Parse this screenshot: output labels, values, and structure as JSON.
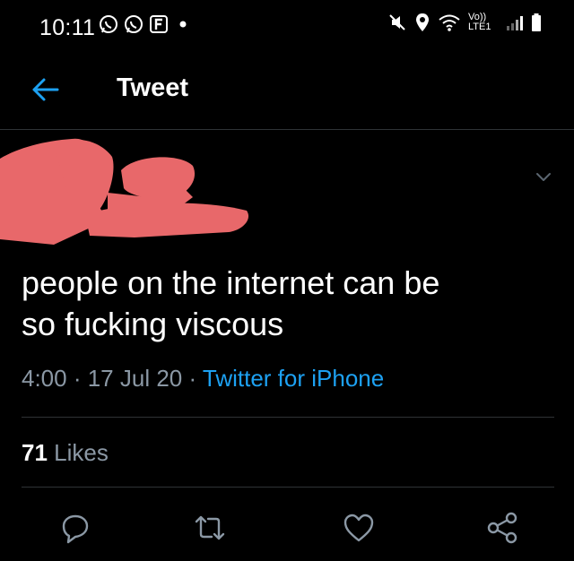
{
  "status_bar": {
    "time": "10:11",
    "network_label": "Vo)) LTE1"
  },
  "header": {
    "title": "Tweet"
  },
  "tweet": {
    "text_line1": "people on the internet can be",
    "text_line2": "so fucking viscous",
    "time": "4:00",
    "date": "17 Jul 20",
    "source": "Twitter for iPhone",
    "separator": " · "
  },
  "stats": {
    "likes_count": "71",
    "likes_label": "Likes"
  },
  "colors": {
    "background": "#000000",
    "text": "#ffffff",
    "muted": "#8b98a5",
    "accent": "#1da1f2",
    "divider": "#2f3336",
    "redaction": "#e8686a"
  },
  "icons": {
    "back": "arrow-left-icon",
    "caret": "chevron-down-icon",
    "reply": "reply-icon",
    "retweet": "retweet-icon",
    "like": "heart-icon",
    "share": "share-icon"
  }
}
